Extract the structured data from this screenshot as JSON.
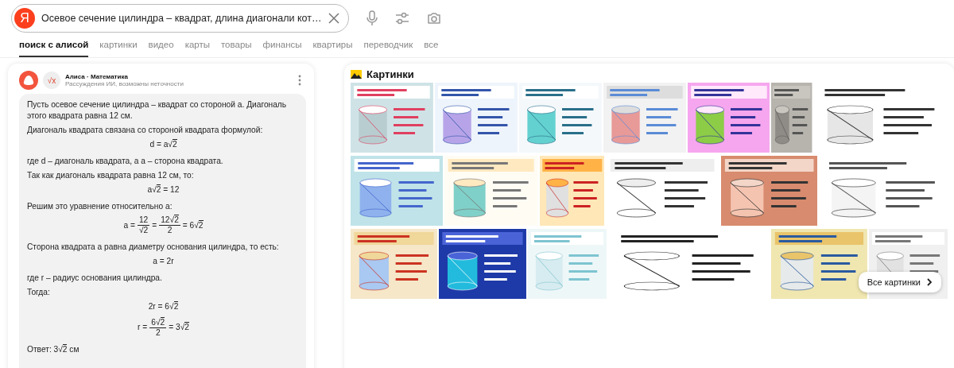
{
  "search": {
    "logo": "Я",
    "value": "Осевое сечение цилиндра – квадрат, длина диагонали кот…"
  },
  "tabs": [
    {
      "label": "поиск с алисой",
      "selected": true
    },
    {
      "label": "картинки",
      "selected": false
    },
    {
      "label": "видео",
      "selected": false
    },
    {
      "label": "карты",
      "selected": false
    },
    {
      "label": "товары",
      "selected": false
    },
    {
      "label": "финансы",
      "selected": false
    },
    {
      "label": "квартиры",
      "selected": false
    },
    {
      "label": "переводчик",
      "selected": false
    },
    {
      "label": "все",
      "selected": false
    }
  ],
  "answer": {
    "math_icon": "√x",
    "source": "Алиса · Математика",
    "note": "Рассуждения ИИ, возможны неточности",
    "blocks": [
      {
        "kind": "text",
        "text": "Пусть осевое сечение цилиндра – квадрат со стороной a. Диагональ этого квадрата равна 12 см."
      },
      {
        "kind": "text",
        "text": "Диагональ квадрата связана со стороной квадрата формулой:"
      },
      {
        "kind": "formula",
        "terms": [
          {
            "kind": "text",
            "text": "d = a√2"
          }
        ]
      },
      {
        "kind": "text",
        "text": "где d – диагональ квадрата, а a – сторона квадрата."
      },
      {
        "kind": "text",
        "text": "Так как диагональ квадрата равна 12 см, то:"
      },
      {
        "kind": "formula",
        "terms": [
          {
            "kind": "text",
            "text": "a√2 = 12"
          }
        ]
      },
      {
        "kind": "text",
        "text": "Решим это уравнение относительно a:"
      },
      {
        "kind": "formula",
        "terms": [
          {
            "kind": "text",
            "text": "a ="
          },
          {
            "kind": "frac",
            "num": "12",
            "den": "√2"
          },
          {
            "kind": "text",
            "text": "="
          },
          {
            "kind": "frac",
            "num": "12√2",
            "den": "2"
          },
          {
            "kind": "text",
            "text": "= 6√2"
          }
        ]
      },
      {
        "kind": "text",
        "text": "Сторона квадрата a равна диаметру основания цилиндра, то есть:"
      },
      {
        "kind": "formula",
        "terms": [
          {
            "kind": "text",
            "text": "a = 2r"
          }
        ]
      },
      {
        "kind": "text",
        "text": "где r – радиус основания цилиндра."
      },
      {
        "kind": "text",
        "text": "Тогда:"
      },
      {
        "kind": "formula",
        "terms": [
          {
            "kind": "text",
            "text": "2r = 6√2"
          }
        ]
      },
      {
        "kind": "formula",
        "terms": [
          {
            "kind": "text",
            "text": "r ="
          },
          {
            "kind": "frac",
            "num": "6√2",
            "den": "2"
          },
          {
            "kind": "text",
            "text": "= 3√2"
          }
        ]
      },
      {
        "kind": "text",
        "text": "Ответ: 3√2 см"
      }
    ]
  },
  "images": {
    "title": "Картинки",
    "all_button": "Все картинки"
  }
}
